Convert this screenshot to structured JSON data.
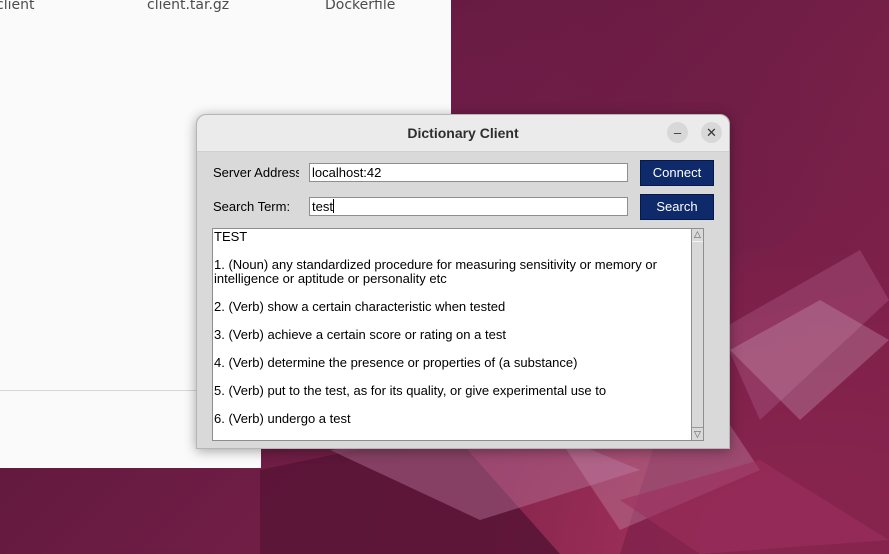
{
  "desktop": {
    "files": [
      "client",
      "client.tar.gz",
      "Dockerfile"
    ]
  },
  "dialog": {
    "title": "Dictionary Client",
    "minimize_icon": "minimize-icon",
    "close_icon": "close-icon",
    "server": {
      "label": "Server Address:",
      "value": "localhost:42",
      "button": "Connect"
    },
    "search": {
      "label": "Search Term:",
      "value": "test",
      "button": "Search"
    },
    "results": {
      "heading": "TEST",
      "definitions": [
        "1. (Noun) any standardized procedure for measuring sensitivity or memory or intelligence or aptitude or personality etc",
        "2. (Verb) show a certain characteristic when tested",
        "3. (Verb) achieve a certain score or rating on a test",
        "4. (Verb) determine the presence or properties of (a substance)",
        "5. (Verb) put to the test, as for its quality, or give experimental use to",
        "6. (Verb) undergo a test"
      ]
    },
    "scrollbar": {
      "up_icon": "scroll-up-arrow-icon",
      "down_icon": "scroll-down-arrow-icon"
    }
  },
  "colors": {
    "button_bg": "#0e2a6b",
    "wallpaper": "#6a1e44"
  }
}
